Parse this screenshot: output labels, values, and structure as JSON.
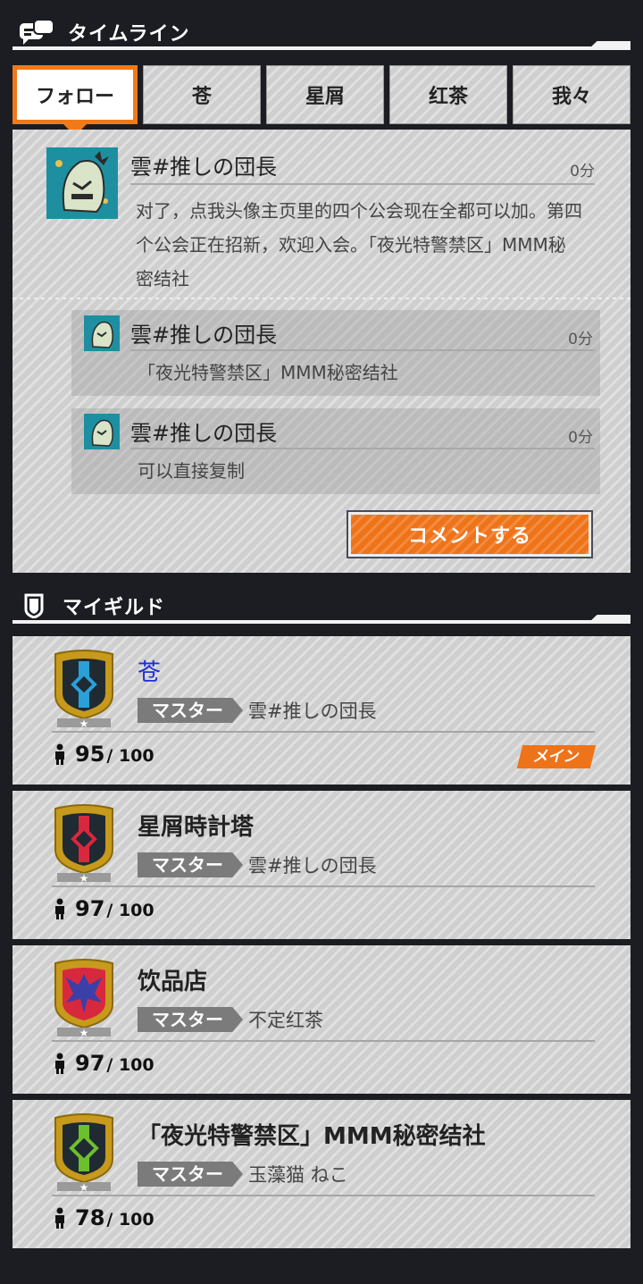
{
  "timeline_header": {
    "title": "タイムライン",
    "icon": "chat-bubbles-icon"
  },
  "tabs": [
    {
      "label": "フォロー",
      "active": true
    },
    {
      "label": "苍",
      "active": false
    },
    {
      "label": "星屑",
      "active": false
    },
    {
      "label": "红茶",
      "active": false
    },
    {
      "label": "我々",
      "active": false
    }
  ],
  "post": {
    "author": "雲#推しの団長",
    "time": "0分",
    "text": "对了，点我头像主页里的四个公会现在全都可以加。第四个公会正在招新，欢迎入会。「夜光特警禁区」MMM秘密结社"
  },
  "replies": [
    {
      "author": "雲#推しの団長",
      "time": "0分",
      "text": "「夜光特警禁区」MMM秘密结社"
    },
    {
      "author": "雲#推しの団長",
      "time": "0分",
      "text": "可以直接复制"
    }
  ],
  "comment_button": {
    "label": "コメントする"
  },
  "guild_header": {
    "title": "マイギルド",
    "icon": "shield-icon"
  },
  "master_label": "マスター",
  "guilds": [
    {
      "name": "苍",
      "master": "雲#推しの団長",
      "members": "95",
      "max": "/ 100",
      "badge": "メイン",
      "emblem_color": "#2aa0d8"
    },
    {
      "name": "星屑時計塔",
      "master": "雲#推しの団長",
      "members": "97",
      "max": "/ 100",
      "emblem_color": "#d8283e"
    },
    {
      "name": "饮品店",
      "master": "不定红茶",
      "members": "97",
      "max": "/ 100",
      "emblem_color": "#3c3fa8"
    },
    {
      "name": "「夜光特警禁区」MMM秘密结社",
      "master": "玉藻猫 ねこ",
      "members": "78",
      "max": "/ 100",
      "emblem_color": "#6cc02c"
    }
  ],
  "colors": {
    "accent": "#ef7318",
    "panel": "#cfcfcf",
    "background": "#1b1d22"
  }
}
